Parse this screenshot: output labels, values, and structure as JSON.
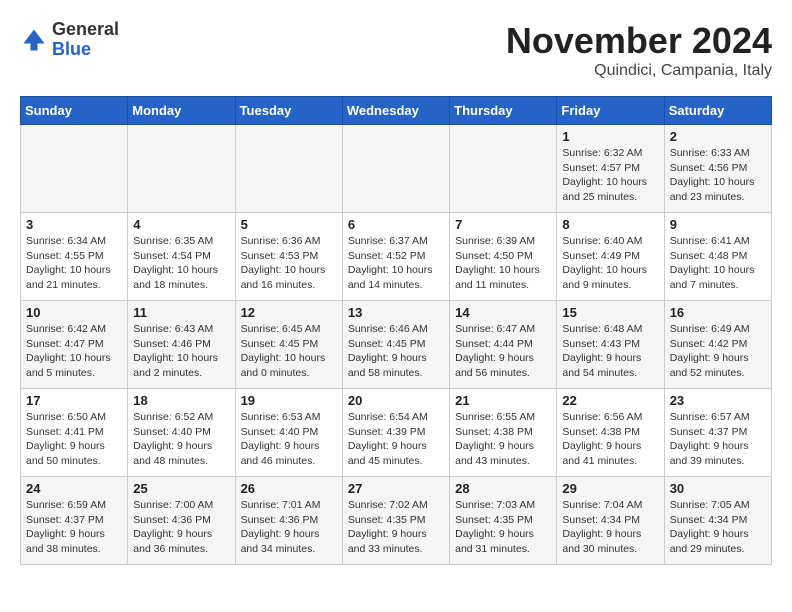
{
  "header": {
    "logo_line1": "General",
    "logo_line2": "Blue",
    "month": "November 2024",
    "location": "Quindici, Campania, Italy"
  },
  "days_of_week": [
    "Sunday",
    "Monday",
    "Tuesday",
    "Wednesday",
    "Thursday",
    "Friday",
    "Saturday"
  ],
  "weeks": [
    [
      {
        "day": "",
        "info": ""
      },
      {
        "day": "",
        "info": ""
      },
      {
        "day": "",
        "info": ""
      },
      {
        "day": "",
        "info": ""
      },
      {
        "day": "",
        "info": ""
      },
      {
        "day": "1",
        "info": "Sunrise: 6:32 AM\nSunset: 4:57 PM\nDaylight: 10 hours and 25 minutes."
      },
      {
        "day": "2",
        "info": "Sunrise: 6:33 AM\nSunset: 4:56 PM\nDaylight: 10 hours and 23 minutes."
      }
    ],
    [
      {
        "day": "3",
        "info": "Sunrise: 6:34 AM\nSunset: 4:55 PM\nDaylight: 10 hours and 21 minutes."
      },
      {
        "day": "4",
        "info": "Sunrise: 6:35 AM\nSunset: 4:54 PM\nDaylight: 10 hours and 18 minutes."
      },
      {
        "day": "5",
        "info": "Sunrise: 6:36 AM\nSunset: 4:53 PM\nDaylight: 10 hours and 16 minutes."
      },
      {
        "day": "6",
        "info": "Sunrise: 6:37 AM\nSunset: 4:52 PM\nDaylight: 10 hours and 14 minutes."
      },
      {
        "day": "7",
        "info": "Sunrise: 6:39 AM\nSunset: 4:50 PM\nDaylight: 10 hours and 11 minutes."
      },
      {
        "day": "8",
        "info": "Sunrise: 6:40 AM\nSunset: 4:49 PM\nDaylight: 10 hours and 9 minutes."
      },
      {
        "day": "9",
        "info": "Sunrise: 6:41 AM\nSunset: 4:48 PM\nDaylight: 10 hours and 7 minutes."
      }
    ],
    [
      {
        "day": "10",
        "info": "Sunrise: 6:42 AM\nSunset: 4:47 PM\nDaylight: 10 hours and 5 minutes."
      },
      {
        "day": "11",
        "info": "Sunrise: 6:43 AM\nSunset: 4:46 PM\nDaylight: 10 hours and 2 minutes."
      },
      {
        "day": "12",
        "info": "Sunrise: 6:45 AM\nSunset: 4:45 PM\nDaylight: 10 hours and 0 minutes."
      },
      {
        "day": "13",
        "info": "Sunrise: 6:46 AM\nSunset: 4:45 PM\nDaylight: 9 hours and 58 minutes."
      },
      {
        "day": "14",
        "info": "Sunrise: 6:47 AM\nSunset: 4:44 PM\nDaylight: 9 hours and 56 minutes."
      },
      {
        "day": "15",
        "info": "Sunrise: 6:48 AM\nSunset: 4:43 PM\nDaylight: 9 hours and 54 minutes."
      },
      {
        "day": "16",
        "info": "Sunrise: 6:49 AM\nSunset: 4:42 PM\nDaylight: 9 hours and 52 minutes."
      }
    ],
    [
      {
        "day": "17",
        "info": "Sunrise: 6:50 AM\nSunset: 4:41 PM\nDaylight: 9 hours and 50 minutes."
      },
      {
        "day": "18",
        "info": "Sunrise: 6:52 AM\nSunset: 4:40 PM\nDaylight: 9 hours and 48 minutes."
      },
      {
        "day": "19",
        "info": "Sunrise: 6:53 AM\nSunset: 4:40 PM\nDaylight: 9 hours and 46 minutes."
      },
      {
        "day": "20",
        "info": "Sunrise: 6:54 AM\nSunset: 4:39 PM\nDaylight: 9 hours and 45 minutes."
      },
      {
        "day": "21",
        "info": "Sunrise: 6:55 AM\nSunset: 4:38 PM\nDaylight: 9 hours and 43 minutes."
      },
      {
        "day": "22",
        "info": "Sunrise: 6:56 AM\nSunset: 4:38 PM\nDaylight: 9 hours and 41 minutes."
      },
      {
        "day": "23",
        "info": "Sunrise: 6:57 AM\nSunset: 4:37 PM\nDaylight: 9 hours and 39 minutes."
      }
    ],
    [
      {
        "day": "24",
        "info": "Sunrise: 6:59 AM\nSunset: 4:37 PM\nDaylight: 9 hours and 38 minutes."
      },
      {
        "day": "25",
        "info": "Sunrise: 7:00 AM\nSunset: 4:36 PM\nDaylight: 9 hours and 36 minutes."
      },
      {
        "day": "26",
        "info": "Sunrise: 7:01 AM\nSunset: 4:36 PM\nDaylight: 9 hours and 34 minutes."
      },
      {
        "day": "27",
        "info": "Sunrise: 7:02 AM\nSunset: 4:35 PM\nDaylight: 9 hours and 33 minutes."
      },
      {
        "day": "28",
        "info": "Sunrise: 7:03 AM\nSunset: 4:35 PM\nDaylight: 9 hours and 31 minutes."
      },
      {
        "day": "29",
        "info": "Sunrise: 7:04 AM\nSunset: 4:34 PM\nDaylight: 9 hours and 30 minutes."
      },
      {
        "day": "30",
        "info": "Sunrise: 7:05 AM\nSunset: 4:34 PM\nDaylight: 9 hours and 29 minutes."
      }
    ]
  ]
}
